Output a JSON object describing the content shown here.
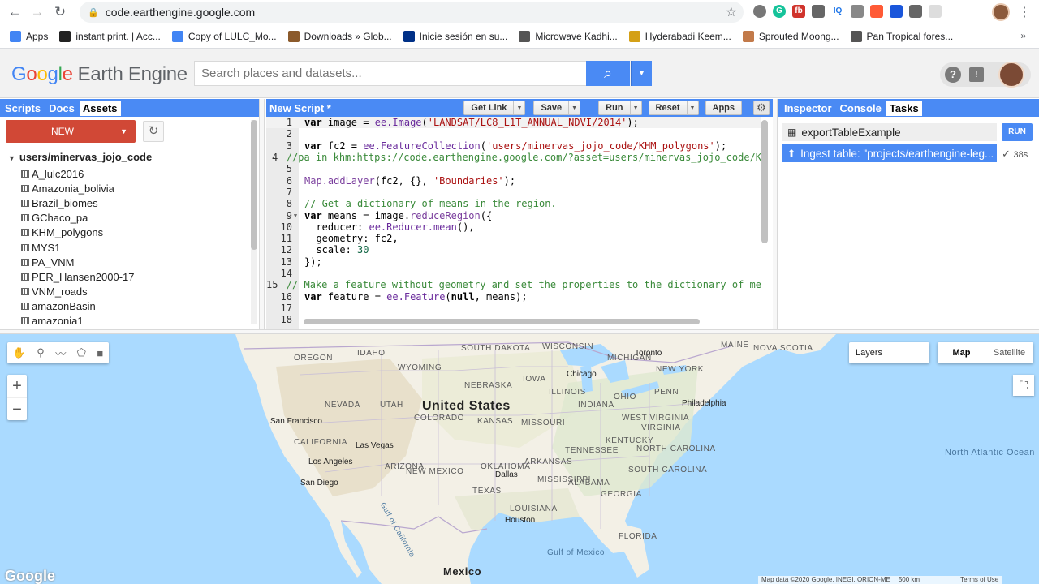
{
  "browser": {
    "url": "code.earthengine.google.com",
    "bookmarks": [
      {
        "label": "Apps",
        "color": "#4285f4"
      },
      {
        "label": "instant print. | Acc...",
        "color": "#222222"
      },
      {
        "label": "Copy of LULC_Mo...",
        "color": "#4285f4"
      },
      {
        "label": "Downloads » Glob...",
        "color": "#8b5a2b"
      },
      {
        "label": "Inicie sesión en su...",
        "color": "#003087"
      },
      {
        "label": "Microwave Kadhi...",
        "color": "#555555"
      },
      {
        "label": "Hyderabadi Keem...",
        "color": "#d4a017"
      },
      {
        "label": "Sprouted Moong...",
        "color": "#c27a4a"
      },
      {
        "label": "Pan Tropical fores...",
        "color": "#555555"
      }
    ],
    "more": "»"
  },
  "header": {
    "logo_g": [
      "G",
      "o",
      "o",
      "g",
      "l",
      "e"
    ],
    "logo_text": "Earth Engine",
    "search_placeholder": "Search places and datasets..."
  },
  "left_panel": {
    "tabs": [
      "Scripts",
      "Docs",
      "Assets"
    ],
    "active_tab": "Assets",
    "new_label": "NEW",
    "root": "users/minervas_jojo_code",
    "assets": [
      "A_lulc2016",
      "Amazonia_bolivia",
      "Brazil_biomes",
      "GChaco_pa",
      "KHM_polygons",
      "MYS1",
      "PA_VNM",
      "PER_Hansen2000-17",
      "VNM_roads",
      "amazonBasin",
      "amazonia1"
    ]
  },
  "center_panel": {
    "title": "New Script *",
    "buttons": {
      "get_link": "Get Link",
      "save": "Save",
      "run": "Run",
      "reset": "Reset",
      "apps": "Apps"
    },
    "code": [
      {
        "n": "1",
        "html": "<span class=\"kw\">var</span> image = <span class=\"ee\">ee.Image</span>(<span class=\"str\">'LANDSAT/LC8_L1T_ANNUAL_NDVI/2014'</span>);"
      },
      {
        "n": "2",
        "html": ""
      },
      {
        "n": "3",
        "html": "<span class=\"kw\">var</span> fc2 = <span class=\"ee\">ee.FeatureCollection</span>(<span class=\"str\">'users/minervas_jojo_code/KHM_polygons'</span>);"
      },
      {
        "n": "4",
        "html": "<span class=\"com\">//pa in khm:https://code.earthengine.google.com/?asset=users/minervas_jojo_code/K</span>"
      },
      {
        "n": "5",
        "html": ""
      },
      {
        "n": "6",
        "html": "<span class=\"fn\">Map.addLayer</span>(fc2, {}, <span class=\"str\">'Boundaries'</span>);"
      },
      {
        "n": "7",
        "html": ""
      },
      {
        "n": "8",
        "html": "<span class=\"com\">// Get a dictionary of means in the region.</span>"
      },
      {
        "n": "9",
        "html": "<span class=\"kw\">var</span> means = image.<span class=\"fn\">reduceRegion</span>({",
        "fold": true
      },
      {
        "n": "10",
        "html": "  reducer: <span class=\"ee\">ee.Reducer.mean</span>(),"
      },
      {
        "n": "11",
        "html": "  geometry: fc2,"
      },
      {
        "n": "12",
        "html": "  scale: <span class=\"num\">30</span>"
      },
      {
        "n": "13",
        "html": "});"
      },
      {
        "n": "14",
        "html": ""
      },
      {
        "n": "15",
        "html": "<span class=\"com\">// Make a feature without geometry and set the properties to the dictionary of me</span>"
      },
      {
        "n": "16",
        "html": "<span class=\"kw\">var</span> feature = <span class=\"ee\">ee.Feature</span>(<span class=\"kw\">null</span>, means);"
      },
      {
        "n": "17",
        "html": ""
      },
      {
        "n": "18",
        "html": ""
      }
    ]
  },
  "right_panel": {
    "tabs": [
      "Inspector",
      "Console",
      "Tasks"
    ],
    "active_tab": "Tasks",
    "task1": "exportTableExample",
    "run_label": "RUN",
    "task2": "Ingest table: \"projects/earthengine-leg...",
    "task2_time": "38s"
  },
  "map": {
    "layers_label": "Layers",
    "map_type": [
      "Map",
      "Satellite"
    ],
    "country": "United States",
    "country2": "Mexico",
    "states": [
      "OREGON",
      "IDAHO",
      "WYOMING",
      "SOUTH DAKOTA",
      "NEBRASKA",
      "NEVADA",
      "UTAH",
      "COLORADO",
      "KANSAS",
      "CALIFORNIA",
      "ARIZONA",
      "NEW MEXICO",
      "OKLAHOMA",
      "TEXAS",
      "IOWA",
      "MISSOURI",
      "ILLINOIS",
      "INDIANA",
      "OHIO",
      "KENTUCKY",
      "TENNESSEE",
      "ARKANSAS",
      "MISSISSIPPI",
      "ALABAMA",
      "GEORGIA",
      "FLORIDA",
      "LOUISIANA",
      "WISCONSIN",
      "MICHIGAN",
      "PENN",
      "NEW YORK",
      "MAINE",
      "NOVA SCOTIA",
      "WEST VIRGINIA",
      "VIRGINIA",
      "NORTH CAROLINA",
      "SOUTH CAROLINA"
    ],
    "cities": [
      "San Francisco",
      "Las Vegas",
      "Los Angeles",
      "San Diego",
      "Chicago",
      "Toronto",
      "Philadelphia",
      "Dallas",
      "Houston"
    ],
    "water_labels": [
      "North Atlantic Ocean",
      "Gulf of Mexico",
      "Gulf of California"
    ],
    "attribution": "Map data ©2020 Google, INEGI, ORION-ME",
    "scale": "500 km",
    "terms": "Terms of Use",
    "google": "Google"
  }
}
